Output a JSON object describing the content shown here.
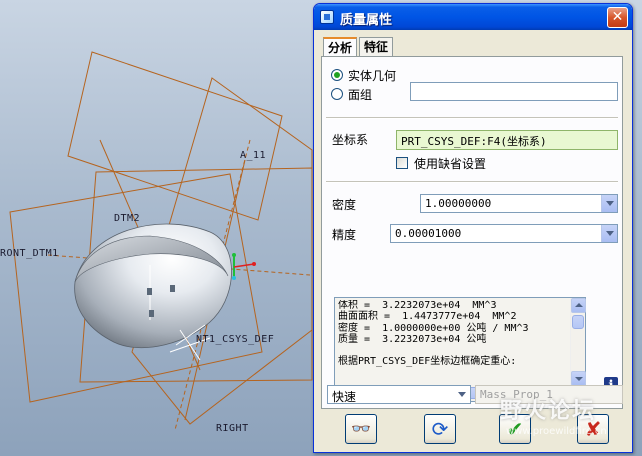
{
  "viewport": {
    "labels": {
      "front_dtm": "RONT_DTM1",
      "dtm2": "DTM2",
      "a_11": "A_11",
      "csys": "NT1_CSYS_DEF",
      "right": "RIGHT"
    }
  },
  "dialog": {
    "title": "质量属性",
    "close_glyph": "✕",
    "tabs": [
      {
        "label": "分析",
        "active": true
      },
      {
        "label": "特征",
        "active": false
      }
    ],
    "geometry_type": {
      "solid_label": "实体几何",
      "quilt_label": "面组",
      "selected": "solid",
      "quilt_value": ""
    },
    "csys": {
      "label": "坐标系",
      "value": "PRT_CSYS_DEF:F4(坐标系)",
      "use_default_label": "使用缺省设置",
      "use_default_checked": false
    },
    "density": {
      "label": "密度",
      "value": "1.00000000"
    },
    "precision": {
      "label": "精度",
      "value": "0.00001000"
    },
    "results": {
      "lines": [
        "体积 =  3.2232073e+04  MM^3",
        "曲面面积 =  1.4473777e+04  MM^2",
        "密度 =  1.0000000e+00 公吨 / MM^3",
        "质量 =  3.2232073e+04 公吨",
        "",
        "根据PRT_CSYS_DEF坐标边框确定重心:"
      ]
    },
    "info_glyph": "i",
    "mode": {
      "value": "快速",
      "name_placeholder": "Mass_Prop_1"
    },
    "footer": {
      "preview_glyph": "👓",
      "repeat_glyph": "⟳",
      "ok_glyph": "✔",
      "cancel_glyph": "✘"
    }
  },
  "watermark": {
    "title": "野火论坛",
    "url": "www.proewildfire.cn"
  },
  "colors": {
    "title_bar": "#0055e5",
    "csys_field_bg": "#e9f8d2",
    "ok_green": "#1f9a1f",
    "cancel_red": "#c8291d",
    "datum_orange": "#b5641f"
  }
}
